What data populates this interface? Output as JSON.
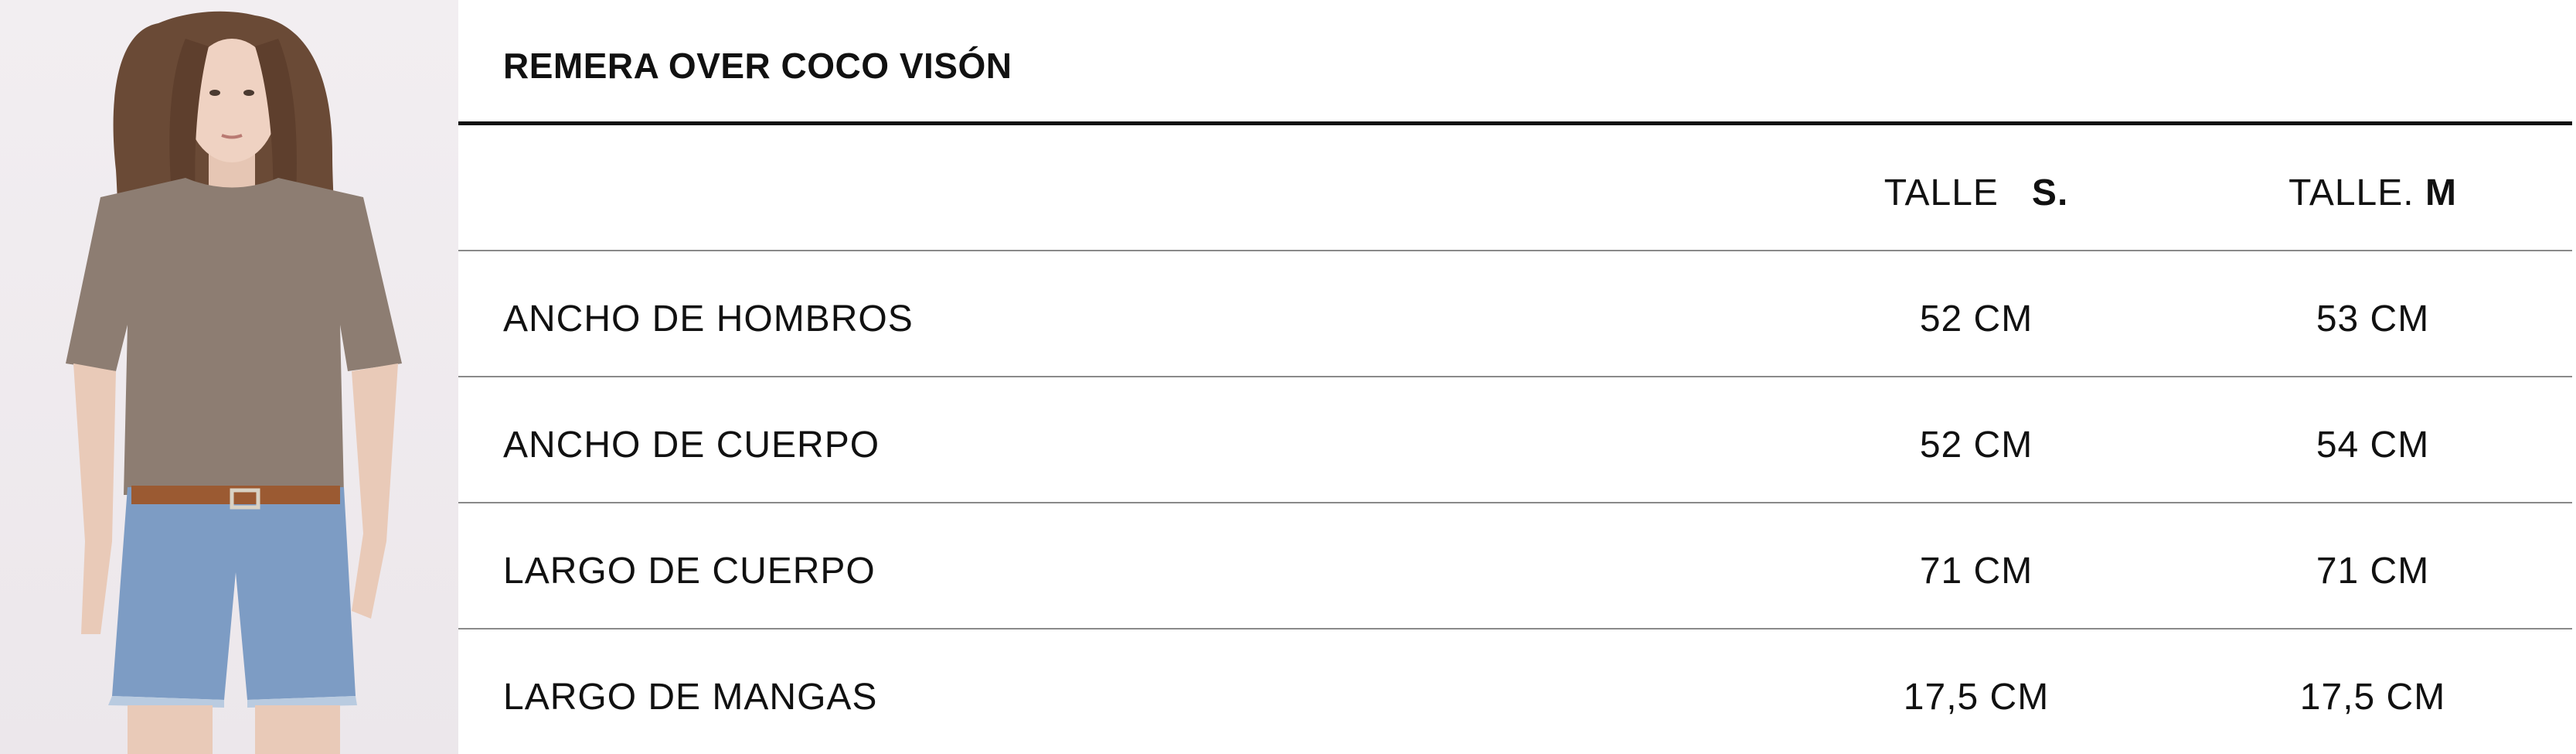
{
  "product": {
    "title": "REMERA OVER COCO VISÓN",
    "photo_alt": "model-photo"
  },
  "header": {
    "size_s_prefix": "TALLE",
    "size_s": "S.",
    "size_m_prefix": "TALLE.",
    "size_m": "M"
  },
  "rows": [
    {
      "label": "ANCHO DE HOMBROS",
      "s": "52 CM",
      "m": "53 CM"
    },
    {
      "label": "ANCHO DE CUERPO",
      "s": "52 CM",
      "m": "54 CM"
    },
    {
      "label": "LARGO DE CUERPO",
      "s": "71 CM",
      "m": "71 CM"
    },
    {
      "label": "LARGO DE MANGAS",
      "s": "17,5 CM",
      "m": "17,5 CM"
    }
  ],
  "colors": {
    "shirt": "#8d7d72",
    "denim": "#7d9cc4",
    "hair": "#6a4a36",
    "belt": "#9b5a32"
  }
}
